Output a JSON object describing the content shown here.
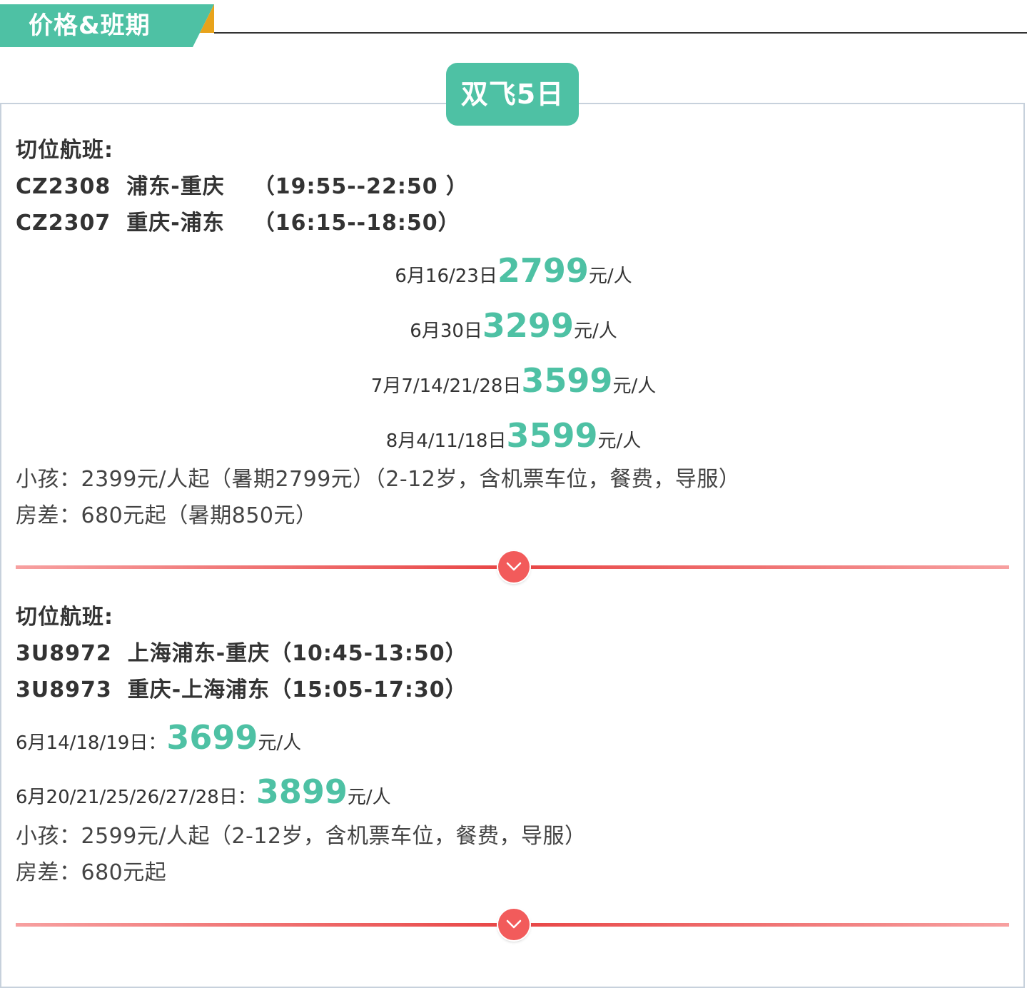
{
  "header": {
    "title": "价格&班期"
  },
  "package": {
    "name": "双飞5日"
  },
  "sections": [
    {
      "flights_label": "切位航班:",
      "flights": [
        {
          "code": "CZ2308",
          "route": "浦东-重庆",
          "time": "（19:55--22:50 ）"
        },
        {
          "code": "CZ2307",
          "route": "重庆-浦东",
          "time": "（16:15--18:50）"
        }
      ],
      "prices": [
        {
          "dates": "6月16/23日",
          "amount": "2799",
          "unit": "元/人"
        },
        {
          "dates": "6月30日",
          "amount": "3299",
          "unit": "元/人"
        },
        {
          "dates": "7月7/14/21/28日",
          "amount": "3599",
          "unit": "元/人"
        },
        {
          "dates": "8月4/11/18日",
          "amount": "3599",
          "unit": "元/人"
        }
      ],
      "child_note": "小孩：2399元/人起（暑期2799元）（2-12岁，含机票车位，餐费，导服）",
      "room_note": "房差：680元起（暑期850元）"
    },
    {
      "flights_label": "切位航班:",
      "flights": [
        {
          "code": "3U8972",
          "route": "上海浦东-重庆",
          "time": "（10:45-13:50）"
        },
        {
          "code": "3U8973",
          "route": "重庆-上海浦东",
          "time": "（15:05-17:30）"
        }
      ],
      "prices": [
        {
          "dates": "6月14/18/19日：",
          "amount": "3699",
          "unit": "元/人"
        },
        {
          "dates": "6月20/21/25/26/27/28日：",
          "amount": "3899",
          "unit": "元/人"
        }
      ],
      "child_note": "小孩：2599元/人起（2-12岁，含机票车位，餐费，导服）",
      "room_note": "房差：680元起"
    }
  ],
  "divider_icon": "chevron-down-icon",
  "colors": {
    "accent": "#4ec1a4",
    "corner": "#e8a31b",
    "divider": "#e84545"
  }
}
